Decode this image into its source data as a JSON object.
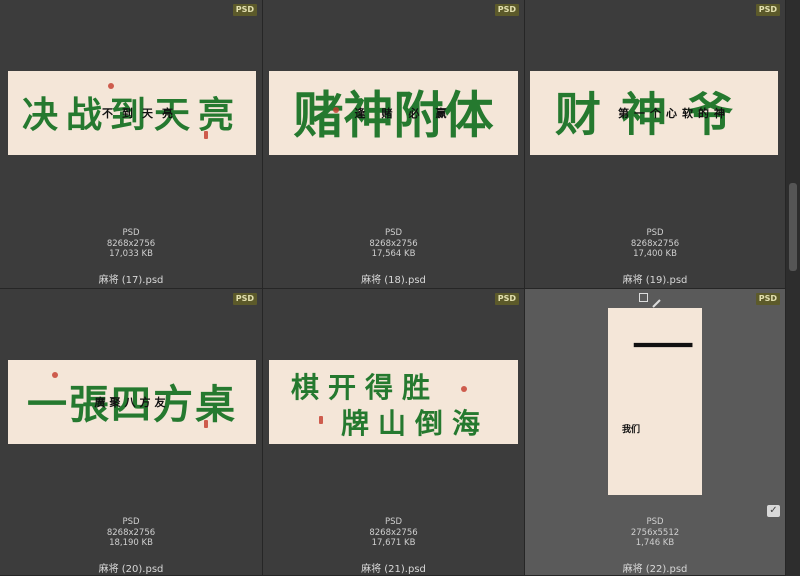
{
  "items": [
    {
      "badge": "PSD",
      "big": "决战到天亮",
      "small": "不到天亮",
      "type": "PSD",
      "dims": "8268x2756",
      "size": "17,033 KB",
      "name": "麻将 (17).psd"
    },
    {
      "badge": "PSD",
      "big": "赌神附体",
      "small": "逢赌必赢",
      "type": "PSD",
      "dims": "8268x2756",
      "size": "17,564 KB",
      "name": "麻将 (18).psd"
    },
    {
      "badge": "PSD",
      "big": "财神爷",
      "small": "第一个心软的神",
      "type": "PSD",
      "dims": "8268x2756",
      "size": "17,400 KB",
      "name": "麻将 (19).psd"
    },
    {
      "badge": "PSD",
      "big": "一張四方桌",
      "small": "廣聚八方友",
      "type": "PSD",
      "dims": "8268x2756",
      "size": "18,190 KB",
      "name": "麻将 (20).psd"
    },
    {
      "badge": "PSD",
      "big1": "棋开得胜",
      "big2": "牌山倒海",
      "type": "PSD",
      "dims": "8268x2756",
      "size": "17,671 KB",
      "name": "麻将 (21).psd"
    },
    {
      "badge": "PSD",
      "big": "一",
      "small": "我们",
      "type": "PSD",
      "dims": "2756x5512",
      "size": "1,746 KB",
      "name": "麻将 (22).psd",
      "checkmark": "✓"
    }
  ],
  "colors": {
    "ink_green": "#25792f",
    "paper": "#f4e6d8",
    "seal": "#c43a2a",
    "badge_bg": "#5c5a2a"
  },
  "icons": {
    "frame": "square-icon",
    "edit": "pen-icon",
    "check": "checkmark-icon"
  }
}
